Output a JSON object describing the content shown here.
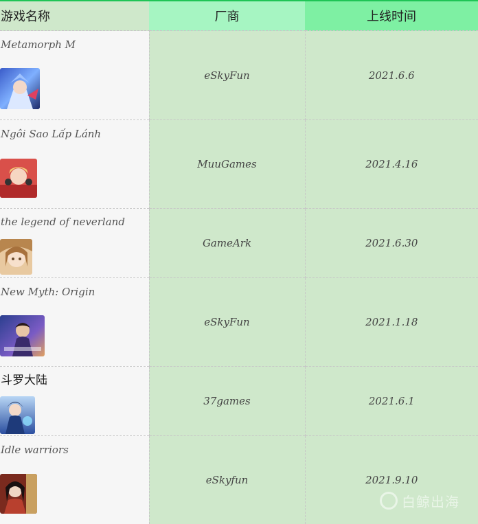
{
  "table": {
    "headers": [
      "游戏名称",
      "厂商",
      "上线时间"
    ],
    "rows": [
      {
        "name": "Metamorph M",
        "vendor": "eSkyFun",
        "date": "2021.6.6",
        "icon": "game-thumbnail-metamorph-m"
      },
      {
        "name": "Ngôi Sao Lấp Lánh",
        "vendor": "MuuGames",
        "date": "2021.4.16",
        "icon": "game-thumbnail-ngoi-sao-lap-lanh"
      },
      {
        "name": "the legend of neverland",
        "vendor": "GameArk",
        "date": "2021.6.30",
        "icon": "game-thumbnail-legend-of-neverland"
      },
      {
        "name": "New Myth: Origin",
        "vendor": "eSkyFun",
        "date": "2021.1.18",
        "icon": "game-thumbnail-new-myth-origin"
      },
      {
        "name": "斗罗大陆",
        "vendor": "37games",
        "date": "2021.6.1",
        "icon": "game-thumbnail-douluo-dalu"
      },
      {
        "name": "Idle warriors",
        "vendor": "eSkyfun",
        "date": "2021.9.10",
        "icon": "game-thumbnail-idle-warriors"
      }
    ]
  },
  "watermark": {
    "text": "白鲸出海",
    "icon": "whale-logo-icon"
  },
  "colors": {
    "header_name": "#cfe8cb",
    "header_vendor": "#a6f5c2",
    "header_date": "#7ef0a3",
    "cell_green": "#cfe8cb",
    "cell_gray": "#f6f6f6",
    "accent_line": "#1fc456"
  }
}
